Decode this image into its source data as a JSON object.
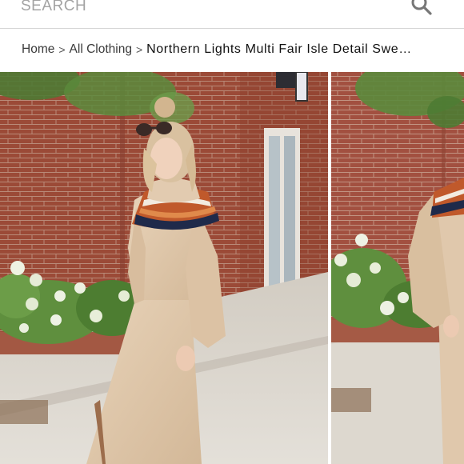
{
  "search": {
    "placeholder": "SEARCH",
    "icon": "search-icon"
  },
  "breadcrumb": {
    "home": "Home",
    "category": "All Clothing",
    "separator": ">",
    "current": "Northern Lights Multi Fair Isle Detail Swe…"
  },
  "gallery": {
    "favorite_icon": "heart-icon",
    "colors": {
      "brick": "#9b4a37",
      "sweater": "#e0c8ac",
      "fairisle_orange": "#c0592b",
      "fairisle_navy": "#1f2a4a",
      "foliage": "#5f8f3e",
      "sidewalk": "#d9d4cc",
      "heart": "#e98fa0"
    }
  }
}
